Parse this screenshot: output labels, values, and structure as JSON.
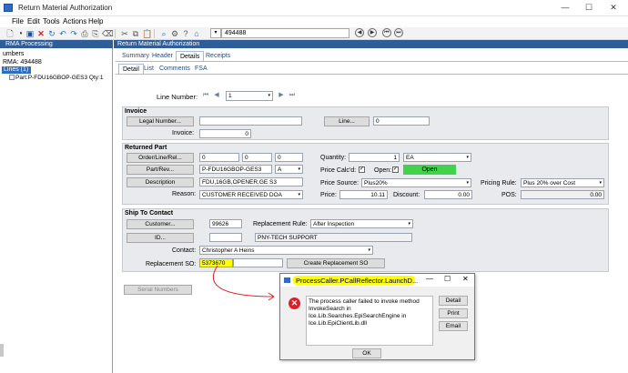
{
  "window": {
    "title": "Return Material Authorization",
    "controls": [
      "—",
      "☐",
      "✕"
    ]
  },
  "menu": [
    "File",
    "Edit",
    "Tools",
    "Actions",
    "Help"
  ],
  "toolbar": {
    "record_value": "494488"
  },
  "left_panel": {
    "header": "RMA Processing",
    "items": [
      "umbers",
      "RMA: 494488",
      "Lines (1)",
      "Part:P-FDU16GBOP-GES3 Qty:1"
    ]
  },
  "right_panel": {
    "header": "Return Material Authorization",
    "tabs": [
      "Summary",
      "Header",
      "Details",
      "Receipts"
    ],
    "active_tab": "Details",
    "subtabs": [
      "Detail",
      "List",
      "Comments",
      "FSA"
    ],
    "active_subtab": "Detail"
  },
  "line_number": {
    "label": "Line Number:",
    "value": "1"
  },
  "invoice": {
    "title": "Invoice",
    "legal_button": "Legal Number...",
    "legal_value": "",
    "line_button": "Line...",
    "line_value": "0",
    "invoice_label": "Invoice:",
    "invoice_value": "0"
  },
  "returned_part": {
    "title": "Returned Part",
    "order_button": "Order/Line/Rel...",
    "order_vals": [
      "0",
      "0",
      "0"
    ],
    "part_button": "Part/Rev...",
    "part_value": "P-FDU16GBOP-GES3",
    "rev_value": "A",
    "desc_button": "Description",
    "desc_value": "FDU,16GB,OPENER,GE S3",
    "reason_label": "Reason:",
    "reason_value": "CUSTOMER RECEIVED DOA",
    "quantity_label": "Quantity:",
    "quantity_value": "1",
    "uom_value": "EA",
    "price_calcd_label": "Price Calc'd:",
    "open_label": "Open:",
    "open_badge": "Open",
    "price_source_label": "Price Source:",
    "price_source_value": "Plus20%",
    "pricing_rule_label": "Pricing Rule:",
    "pricing_rule_value": "Plus 20% over Cost",
    "price_label": "Price:",
    "price_value": "10.11",
    "discount_label": "Discount:",
    "discount_value": "0.00",
    "pos_label": "POS:",
    "pos_value": "0.00"
  },
  "ship_to": {
    "title": "Ship To Contact",
    "customer_button": "Customer...",
    "customer_value": "99626",
    "id_button": "ID...",
    "id_value": "PNY-TECH SUPPORT",
    "replacement_rule_label": "Replacement Rule:",
    "replacement_rule_value": "After Inspection",
    "contact_label": "Contact:",
    "contact_value": "Christopher A Heins",
    "replacement_so_label": "Replacement SO:",
    "replacement_so_value": "5373670",
    "create_replacement_button": "Create Replacement SO"
  },
  "serial_button": "Serial Numbers",
  "dialog": {
    "title": "ProcessCaller.PCallReflector.LaunchD...",
    "message": [
      "The process caller failed to invoke method",
      "InvokeSearch in",
      "Ice.Lib.Searches.EpiSearchEngine in",
      "Ice.Lib.EpiClientLib.dll"
    ],
    "buttons": [
      "Detail",
      "Print",
      "Email"
    ],
    "ok": "OK",
    "controls": [
      "—",
      "☐",
      "✕"
    ]
  },
  "colors": {
    "header_blue": "#2e5d99",
    "highlight": "#ffff00",
    "annotation": "#e02020",
    "open_green": "#3fd24a"
  }
}
